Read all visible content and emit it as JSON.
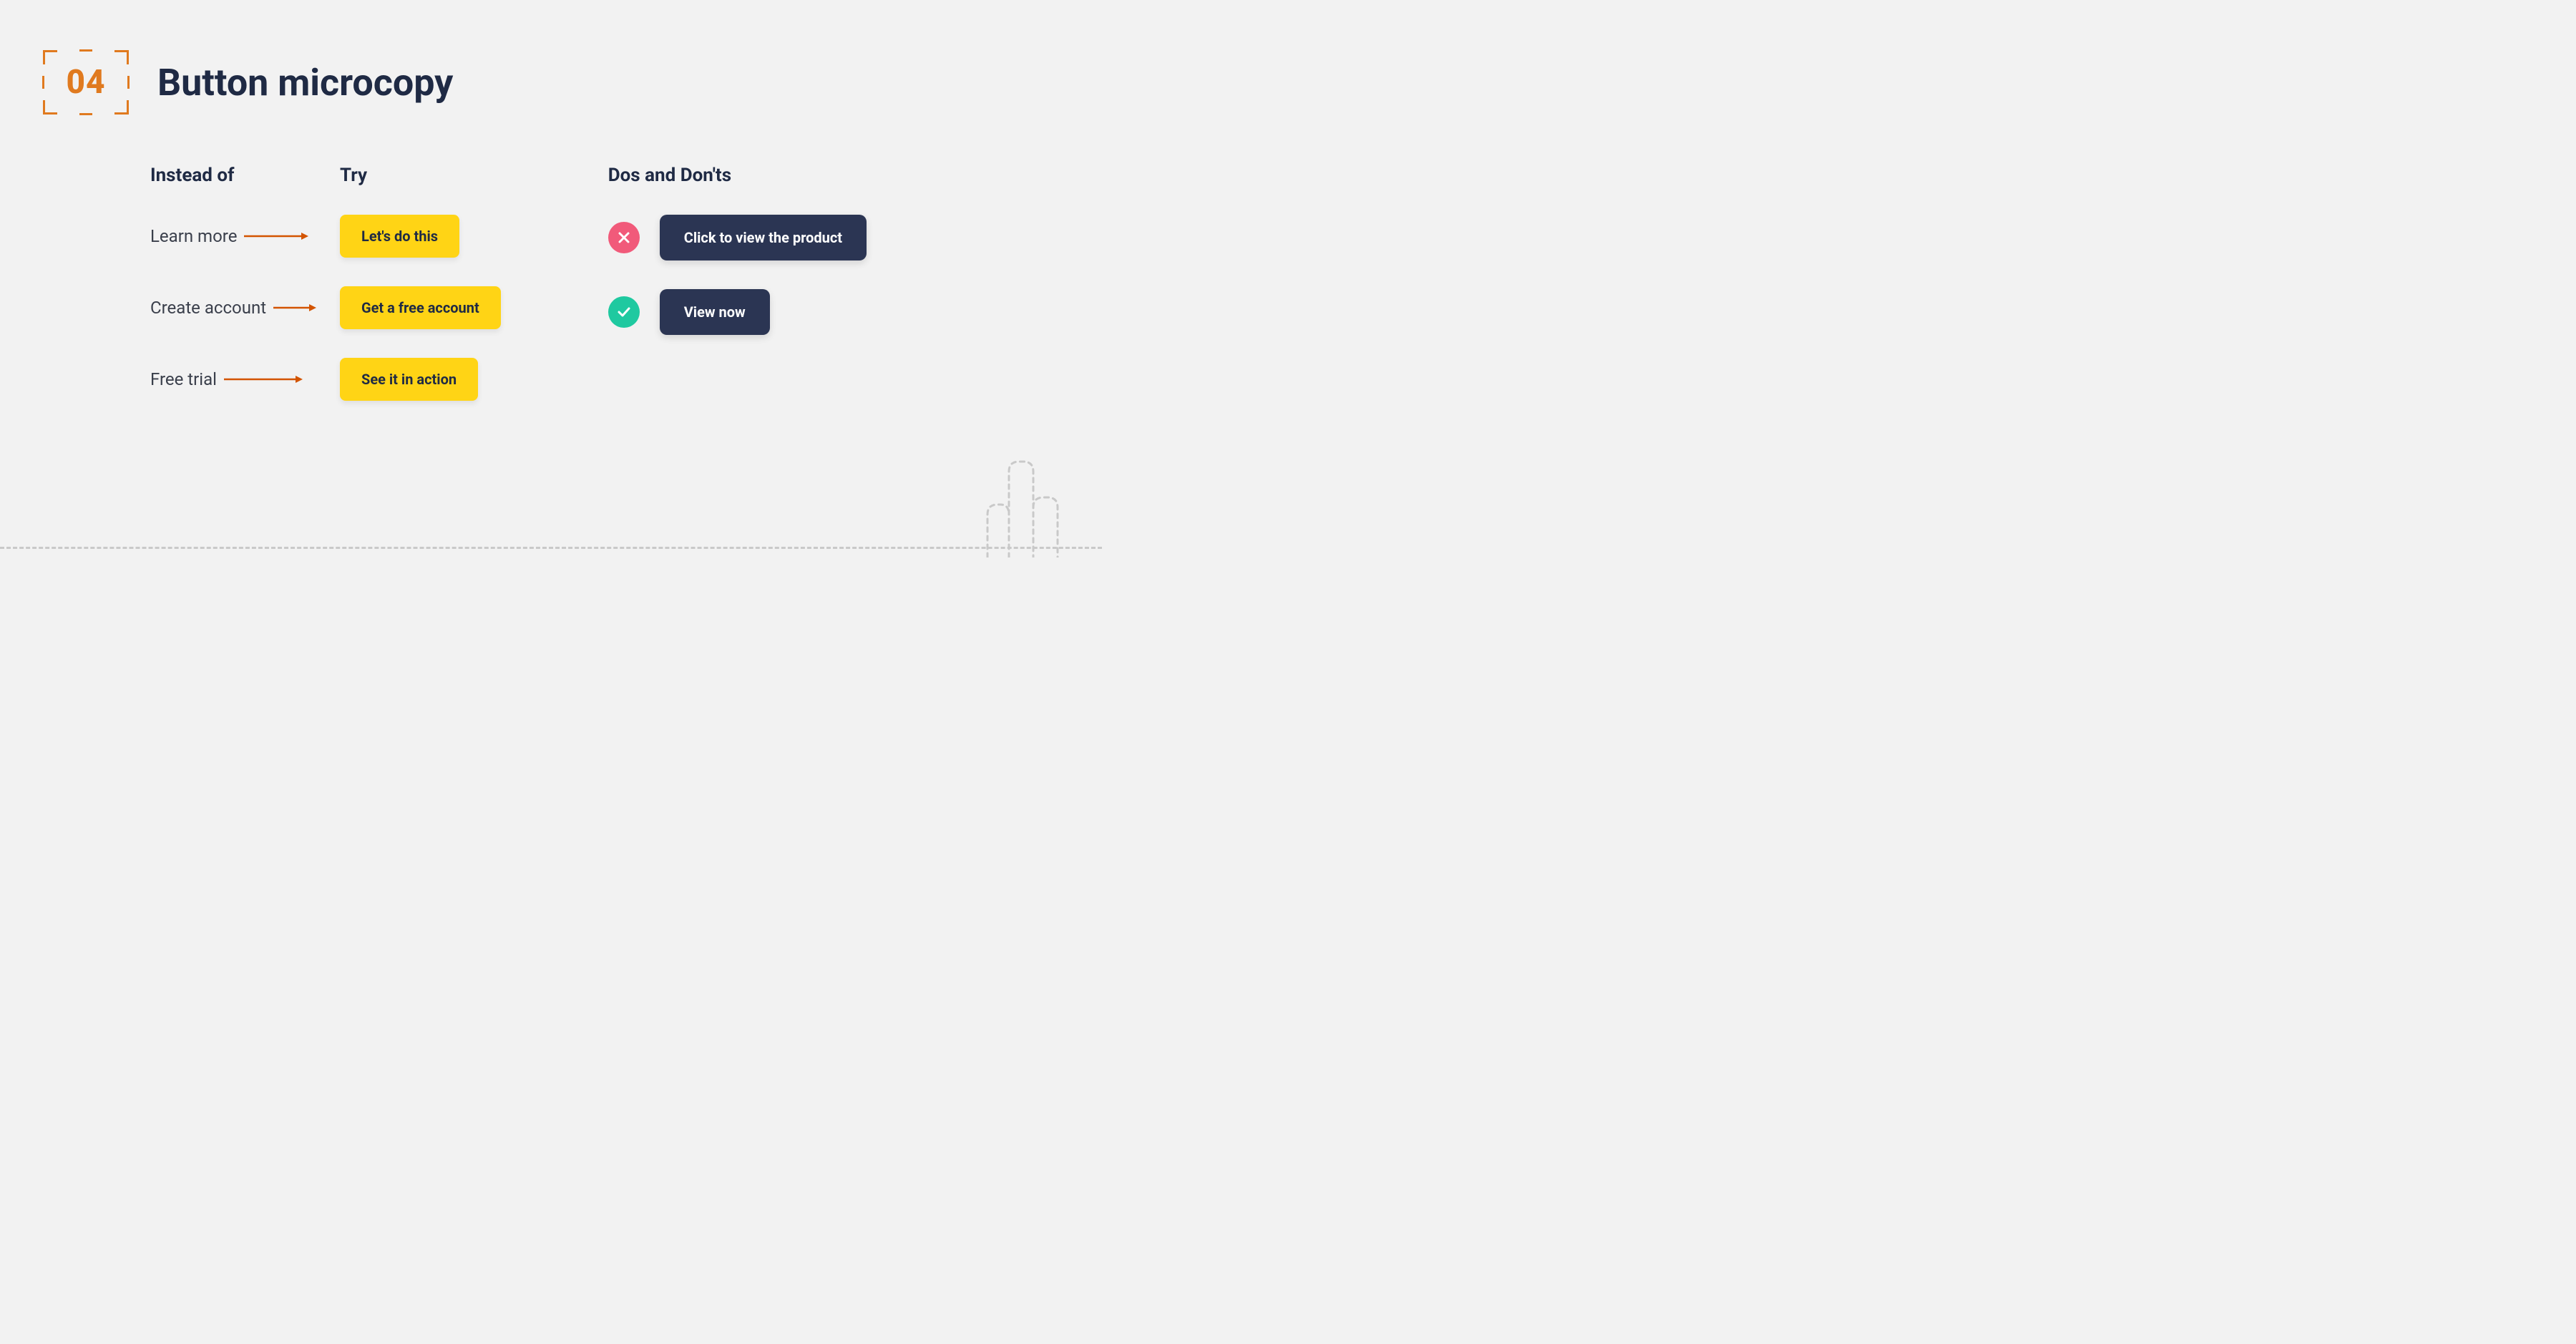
{
  "header": {
    "number": "04",
    "title": "Button microcopy"
  },
  "columns": {
    "instead_label": "Instead of",
    "try_label": "Try"
  },
  "rows": [
    {
      "instead": "Learn more",
      "try": "Let's do this"
    },
    {
      "instead": "Create account",
      "try": "Get a free account"
    },
    {
      "instead": "Free trial",
      "try": "See it in action"
    }
  ],
  "dos_donts": {
    "heading": "Dos and Don'ts",
    "bad": "Click to view the product",
    "good": "View now"
  },
  "colors": {
    "accent_orange": "#e07a1f",
    "button_yellow": "#ffd415",
    "button_dark": "#2b3553",
    "badge_bad": "#f15a7a",
    "badge_good": "#1fc9a0",
    "text_dark": "#1f2a44",
    "background": "#f2f2f2"
  }
}
